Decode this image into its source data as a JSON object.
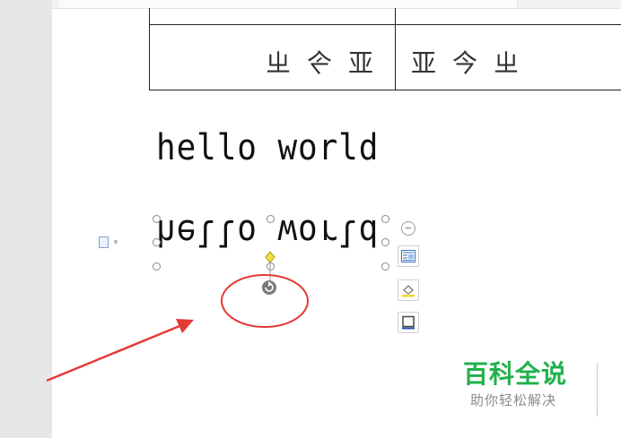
{
  "document": {
    "hello_text": "hello world",
    "hello_mirrored_text": "hello world",
    "table_cell_left_chars": "亚今ㄓ",
    "table_cell_right_chars": "亚今ㄓ"
  },
  "toolbar": {
    "collapse_icon": "minus-circle-icon",
    "layout_options_icon": "text-wrap-icon",
    "fill_icon": "paint-bucket-icon",
    "outline_icon": "square-outline-icon"
  },
  "annotation": {
    "circle_color": "#e53935",
    "arrow_color": "#e53935"
  },
  "watermark": {
    "title": "百科全说",
    "subtitle": "助你轻松解决",
    "title_color": "#21b14b"
  },
  "colors": {
    "page_bg": "#ffffff",
    "workspace_bg": "#e6e6e6",
    "handle_yellow": "#f2e14a"
  }
}
